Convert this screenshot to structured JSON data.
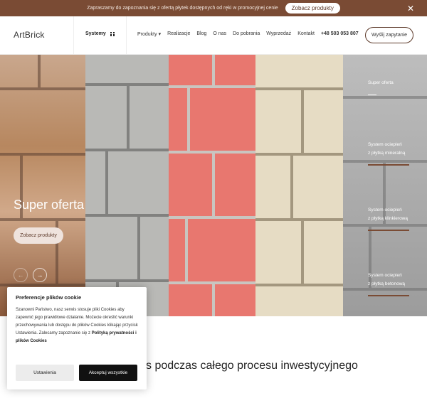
{
  "promo": {
    "text": "Zapraszamy do zapoznania się z ofertą płytek dostępnych od ręki w promocyjnej cenie",
    "button": "Zobacz produkty",
    "close": "✕"
  },
  "header": {
    "logo": "ArtBrick",
    "systemy": "Systemy",
    "nav": [
      "Produkty ▾",
      "Realizacje",
      "Blog",
      "O nas",
      "Do pobrania",
      "Wyprzedaż",
      "Kontakt"
    ],
    "phone": "+48 503 053 807",
    "ask_button": "Wyślij zapytanie"
  },
  "hero": {
    "title": "Super oferta",
    "button": "Zobacz produkty",
    "prev": "←",
    "next": "→",
    "side": {
      "item1": "Super oferta",
      "item2_l1": "System ociepleń",
      "item2_l2": "z płytką mineralną",
      "item3_l1": "System ociepleń",
      "item3_l2": "z płytką klinkierową",
      "item4_l1": "System ociepleń",
      "item4_l2": "z płytką betonową"
    }
  },
  "tagline": "s podczas całego procesu inwestycyjnego",
  "cookie": {
    "title": "Preferencje plików cookie",
    "text": "Szanowni Państwo, nasz serwis stosuje pliki Cookies aby zapewnić jego prawidłowe działanie. Możecie określić warunki przechowywania lub dostępu do plików Cookies klikając przycisk Ustawienia. Zalecamy zapoznanie się z ",
    "link": "Polityką prywatności i plików Cookies",
    "settings": "Ustawienia",
    "accept": "Akceptuj wszystkie"
  },
  "colors": {
    "brand": "#7a4b34",
    "accent": "#5d3a2a"
  }
}
